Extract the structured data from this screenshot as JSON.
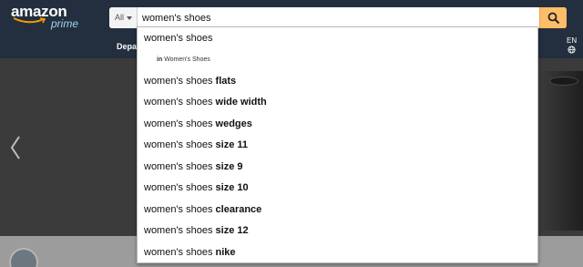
{
  "header": {
    "logo_word": "amazon",
    "logo_sub": "prime",
    "search": {
      "category": "All",
      "query": "women's shoes"
    },
    "departments_label": "Depa",
    "lang_label": "EN"
  },
  "suggestions": {
    "first": "women's shoes",
    "category_prefix": "in",
    "category_name": "Women's Shoes",
    "items": [
      {
        "base": "women's shoes ",
        "bold": "flats"
      },
      {
        "base": "women's shoes ",
        "bold": "wide width"
      },
      {
        "base": "women's shoes ",
        "bold": "wedges"
      },
      {
        "base": "women's shoes ",
        "bold": "size 11"
      },
      {
        "base": "women's shoes ",
        "bold": "size 9"
      },
      {
        "base": "women's shoes ",
        "bold": "size 10"
      },
      {
        "base": "women's shoes ",
        "bold": "clearance"
      },
      {
        "base": "women's shoes ",
        "bold": "size 12"
      },
      {
        "base": "women's shoes ",
        "bold": "nike"
      }
    ]
  },
  "icons": {
    "search": "search-icon",
    "globe": "globe-icon",
    "prev": "chevron-left-icon",
    "caret": "caret-down-icon"
  },
  "colors": {
    "nav_bg": "#232f3e",
    "search_button": "#febd69"
  }
}
